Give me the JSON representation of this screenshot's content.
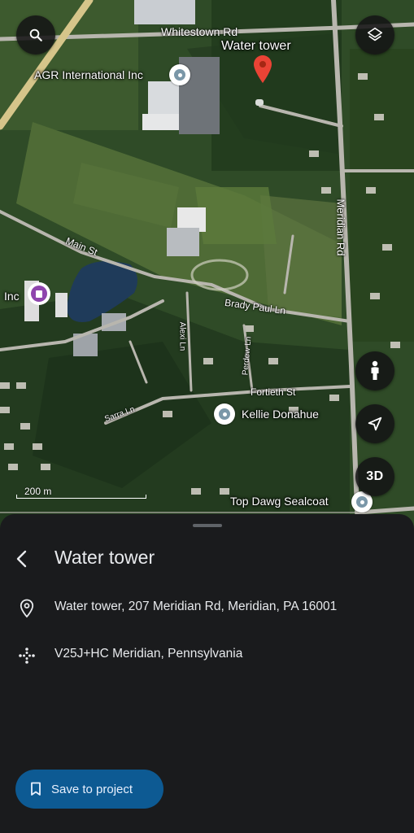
{
  "map": {
    "roads": {
      "whitestown": "Whitestown Rd",
      "meridian": "Meridian Rd",
      "main": "Main St",
      "brady_paul": "Brady Paul Ln",
      "alexi": "Alexi Ln",
      "perdew": "Perdew Ln",
      "fortieth": "Fortieth St",
      "sarra": "Sarra Ln"
    },
    "places": {
      "water_tower": "Water tower",
      "agr": "AGR International Inc",
      "inc": "Inc",
      "kellie": "Kellie Donahue",
      "top_dawg": "Top Dawg Sealcoat"
    },
    "scale_text": "200 m",
    "buttons": {
      "search_icon": "search-icon",
      "layers_icon": "layers-icon",
      "pegman_icon": "pegman-icon",
      "locate_icon": "navigation-arrow-icon",
      "three_d": "3D"
    }
  },
  "sheet": {
    "title": "Water tower",
    "address": "Water tower, 207 Meridian Rd, Meridian, PA 16001",
    "plus_code": "V25J+HC Meridian, Pennsylvania",
    "save_label": "Save to project"
  },
  "colors": {
    "sheet_bg": "#1a1b1d",
    "save_button": "#0d5a93",
    "selected_pin": "#ea4335",
    "purple_poi": "#8e44ad"
  }
}
